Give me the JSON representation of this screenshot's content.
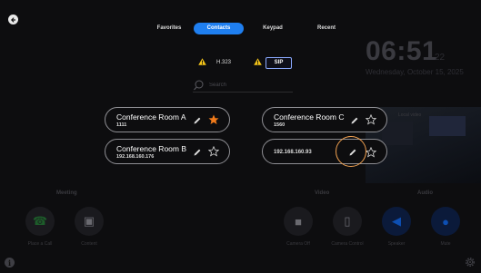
{
  "tabs": [
    {
      "label": "Favorites",
      "active": false
    },
    {
      "label": "Contacts",
      "active": true
    },
    {
      "label": "Keypad",
      "active": false
    },
    {
      "label": "Recent",
      "active": false
    }
  ],
  "protocols": [
    {
      "label": "H.323",
      "selected": false,
      "warning": true
    },
    {
      "label": "SIP",
      "selected": true,
      "warning": true
    }
  ],
  "search": {
    "placeholder": "Search",
    "value": ""
  },
  "contacts": [
    {
      "name": "Conference Room A",
      "address": "1111",
      "favorite": true
    },
    {
      "name": "Conference Room C",
      "address": "1560",
      "favorite": false
    },
    {
      "name": "Conference Room B",
      "address": "192.168.160.176",
      "favorite": false
    },
    {
      "name": "",
      "address": "192.168.160.93",
      "favorite": false
    }
  ],
  "background": {
    "clock": "06:51",
    "clock_seconds": "22",
    "date": "Wednesday, October 15, 2025",
    "preview_label": "Local video",
    "sections": {
      "meeting": "Meeting",
      "video": "Video",
      "audio": "Audio"
    },
    "buttons": [
      {
        "label": "Place a Call",
        "icon": "phone-icon"
      },
      {
        "label": "Content",
        "icon": "content-share-icon"
      },
      {
        "label": "Camera Off",
        "icon": "camera-icon"
      },
      {
        "label": "Camera Control",
        "icon": "camera-control-icon"
      },
      {
        "label": "Speaker",
        "icon": "speaker-icon"
      },
      {
        "label": "Mute",
        "icon": "microphone-icon"
      }
    ]
  },
  "colors": {
    "accent": "#1f7ff0",
    "favorite_star": "#f07a1a",
    "warning": "#f5c518",
    "highlight_ring": "#f0a050",
    "pill_border": "#8e8e93"
  }
}
